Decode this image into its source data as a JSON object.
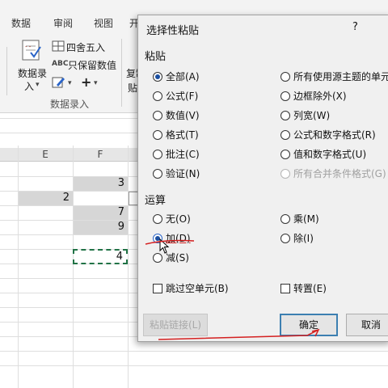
{
  "ribbon": {
    "tabs": [
      "数据",
      "审阅",
      "视图",
      "开"
    ],
    "data_entry_label": "数据录",
    "data_entry_label2": "入",
    "round_label": "四舍五入",
    "abc_label": "ABC",
    "keep_values_label": "只保留数值",
    "group_label": "数据录入",
    "copy_label": "复制",
    "paste_label": "贴"
  },
  "sheet": {
    "columns": [
      "E",
      "F"
    ],
    "cells": {
      "f1": "3",
      "e2": "2",
      "f3": "7",
      "f4": "9",
      "f5": "4"
    }
  },
  "dialog": {
    "title": "选择性粘贴",
    "help": "?",
    "paste_section": "粘贴",
    "paste_left": [
      "全部(A)",
      "公式(F)",
      "数值(V)",
      "格式(T)",
      "批注(C)",
      "验证(N)"
    ],
    "paste_right": [
      "所有使用源主题的单元",
      "边框除外(X)",
      "列宽(W)",
      "公式和数字格式(R)",
      "值和数字格式(U)",
      "所有合并条件格式(G)"
    ],
    "operation_section": "运算",
    "op_left": [
      "无(O)",
      "加(D)",
      "减(S)"
    ],
    "op_right": [
      "乘(M)",
      "除(I)"
    ],
    "skip_blanks": "跳过空单元(B)",
    "transpose": "转置(E)",
    "paste_link": "粘贴链接(L)",
    "ok": "确定",
    "cancel": "取消"
  }
}
